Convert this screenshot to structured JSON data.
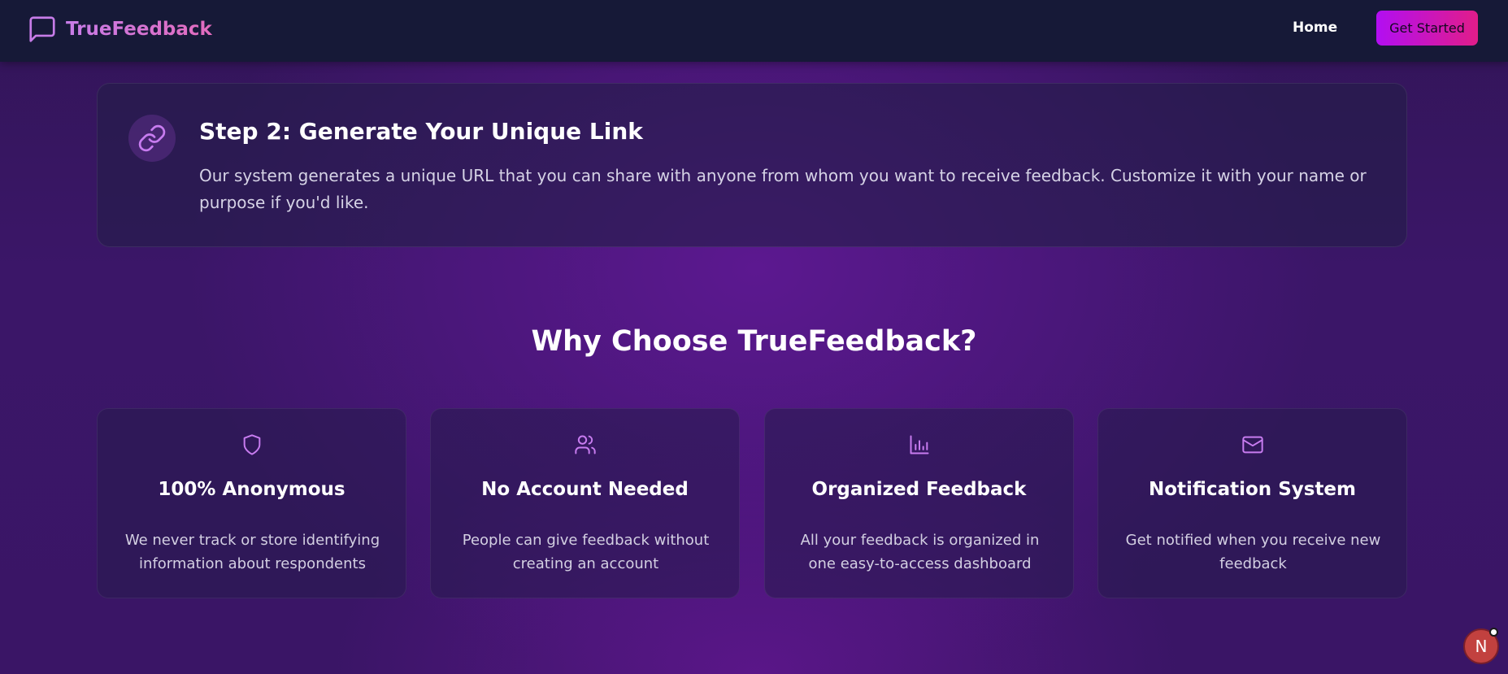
{
  "header": {
    "brand_name": "TrueFeedback",
    "brand_icon": "message-square-icon",
    "nav_home": "Home",
    "cta_label": "Get Started"
  },
  "step": {
    "icon": "link-icon",
    "title": "Step 2: Generate Your Unique Link",
    "description": "Our system generates a unique URL that you can share with anyone from whom you want to receive feedback. Customize it with your name or purpose if you'd like."
  },
  "features_section": {
    "title": "Why Choose TrueFeedback?",
    "items": [
      {
        "icon": "shield-icon",
        "title": "100% Anonymous",
        "description": "We never track or store identifying information about respondents"
      },
      {
        "icon": "users-icon",
        "title": "No Account Needed",
        "description": "People can give feedback without creating an account"
      },
      {
        "icon": "bar-chart-icon",
        "title": "Organized Feedback",
        "description": "All your feedback is organized in one easy-to-access dashboard"
      },
      {
        "icon": "mail-icon",
        "title": "Notification System",
        "description": "Get notified when you receive new feedback"
      }
    ]
  },
  "dev_indicator": {
    "letter": "N"
  },
  "colors": {
    "accent_purple": "#c77ce8",
    "accent_pink": "#e11d89",
    "header_bg": "#161937",
    "icon_color": "#c87cf0"
  }
}
